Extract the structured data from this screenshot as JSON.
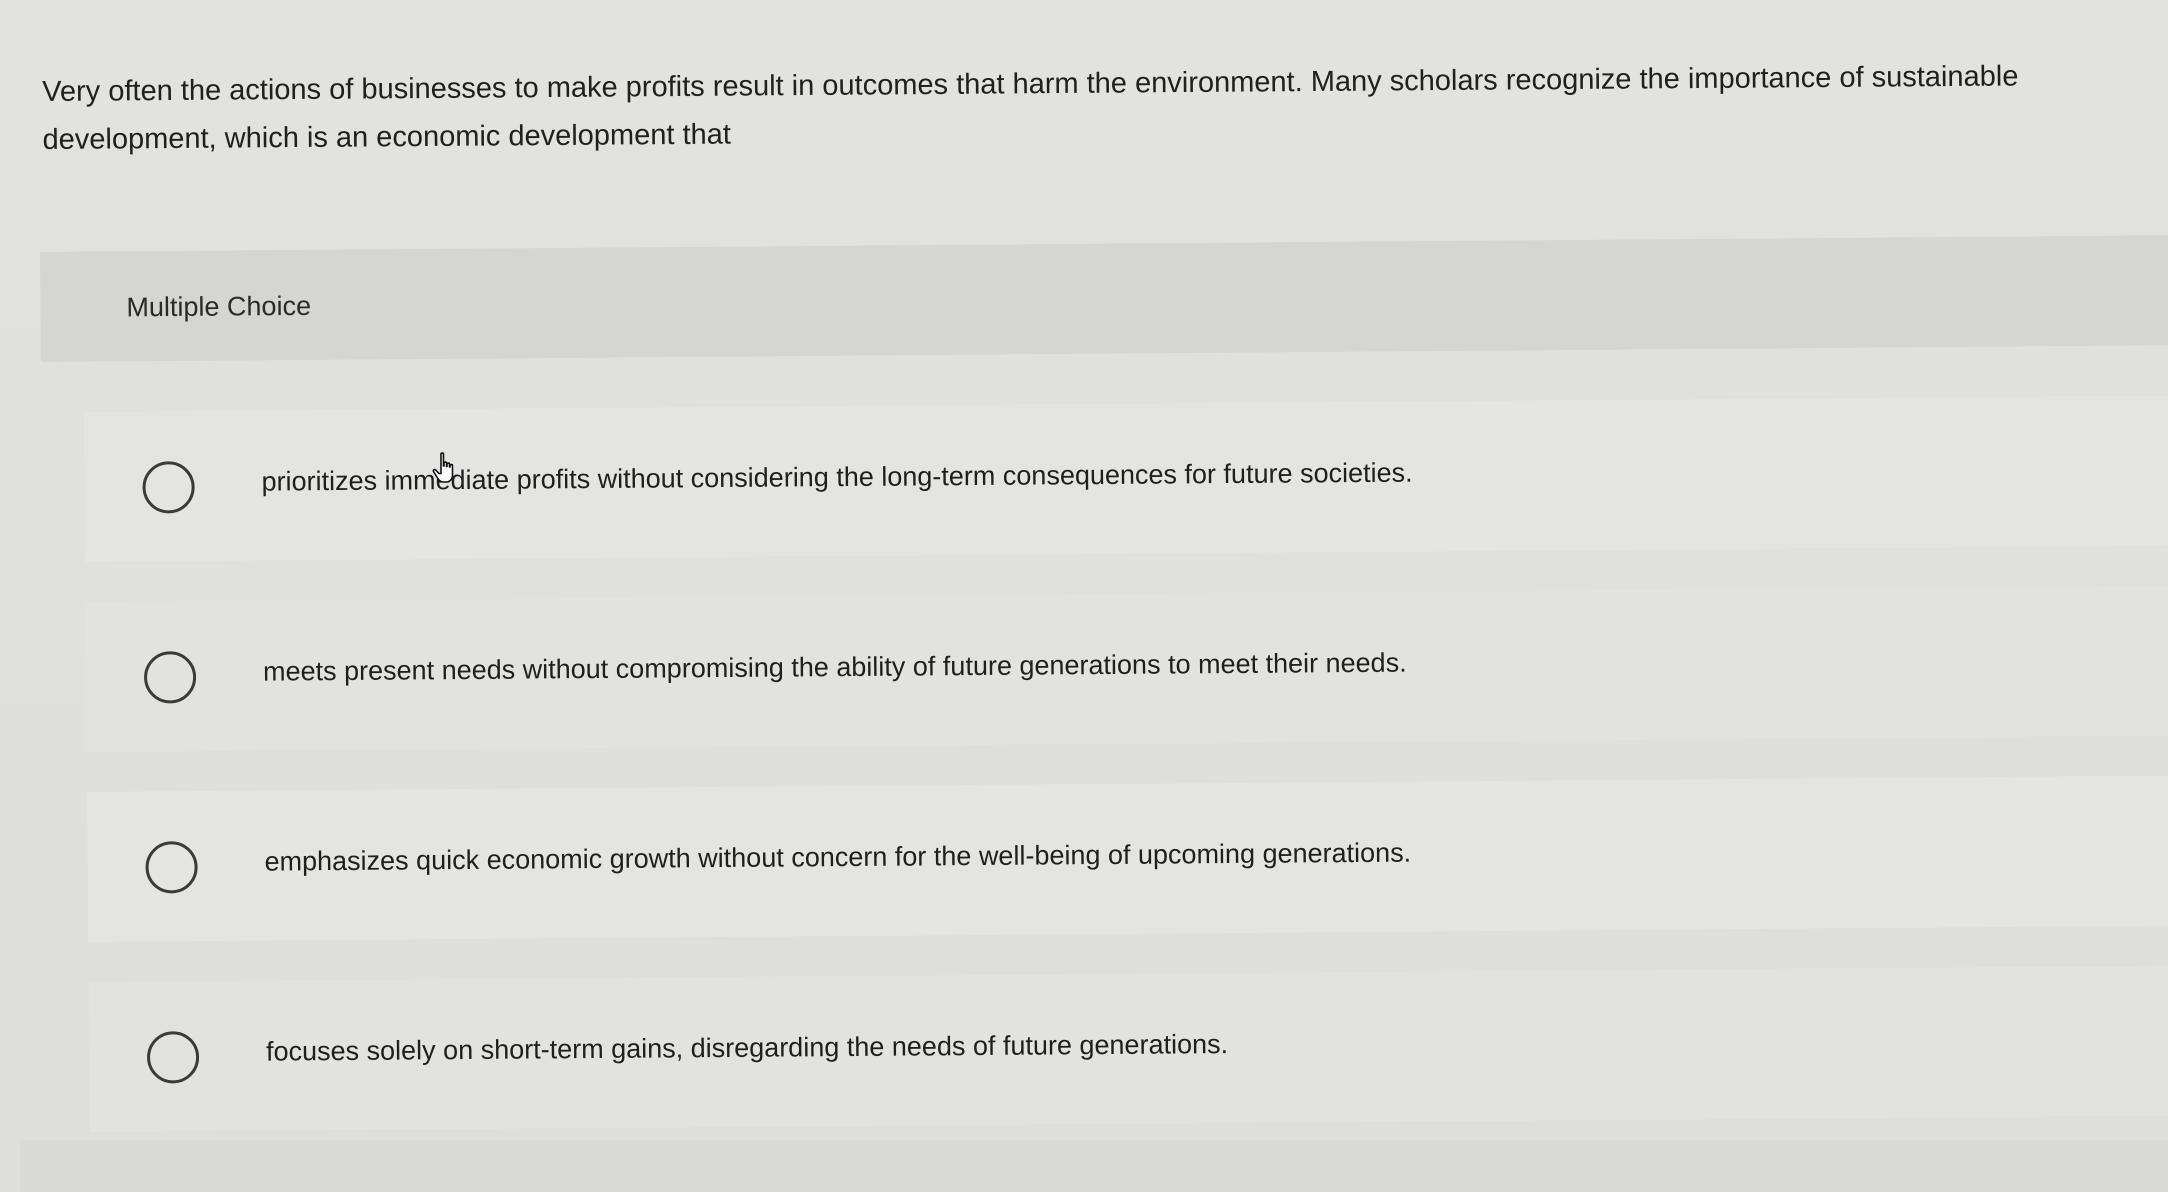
{
  "question": {
    "text": "Very often the actions of businesses to make profits result in outcomes that harm the environment. Many scholars recognize the importance of sustainable development, which is an economic development that"
  },
  "multiple_choice": {
    "title": "Multiple Choice"
  },
  "options": [
    {
      "text": "prioritizes immediate profits without considering the long-term consequences for future societies.",
      "selected": false
    },
    {
      "text": "meets present needs without compromising the ability of future generations to meet their needs.",
      "selected": false
    },
    {
      "text": "emphasizes quick economic growth without concern for the well-being of upcoming generations.",
      "selected": false
    },
    {
      "text": "focuses solely on short-term gains, disregarding the needs of future generations.",
      "selected": false
    }
  ],
  "icons": {
    "radio": "radio-button-icon",
    "cursor": "hand-pointer-icon"
  },
  "colors": {
    "background": "#dcdcda",
    "text": "#1d1d1d",
    "radio_border": "#3a3a3a"
  }
}
